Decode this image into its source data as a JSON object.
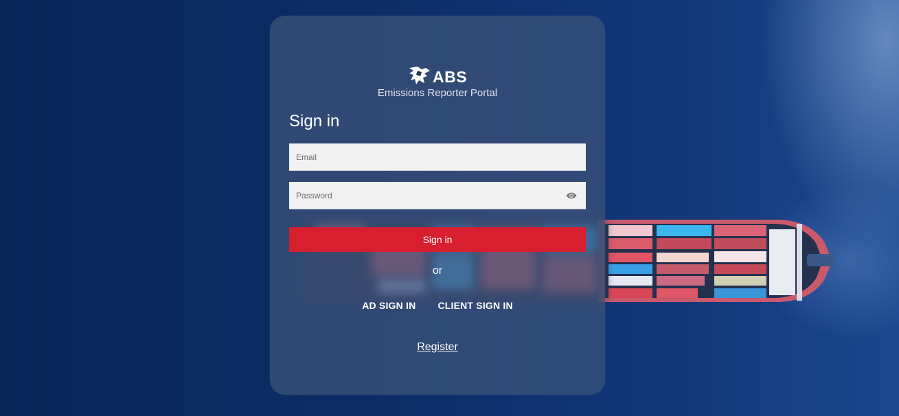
{
  "brand": {
    "logo_text": "ABS",
    "portal_title": "Emissions Reporter Portal"
  },
  "form": {
    "heading": "Sign in",
    "email_placeholder": "Email",
    "password_placeholder": "Password",
    "submit_label": "Sign in",
    "separator": "or",
    "ad_signin_label": "AD SIGN IN",
    "client_signin_label": "CLIENT SIGN IN",
    "register_label": "Register"
  },
  "colors": {
    "primary_button": "#d71f30",
    "card_background": "#3e547a",
    "page_background": "#0d2c66"
  },
  "icons": {
    "logo": "abs-eagle-logo-icon",
    "password_toggle": "eye-icon"
  }
}
